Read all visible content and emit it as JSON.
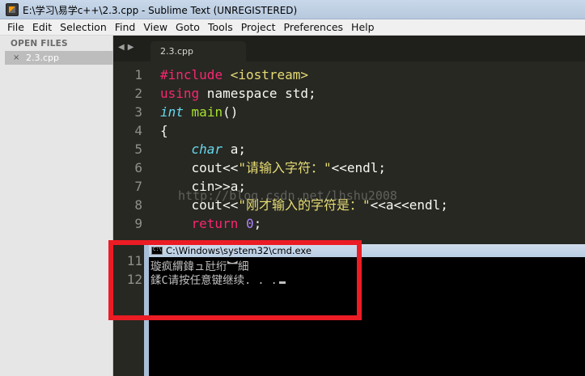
{
  "window": {
    "title": "E:\\学习\\易学c++\\2.3.cpp - Sublime Text (UNREGISTERED)"
  },
  "menu": [
    "File",
    "Edit",
    "Selection",
    "Find",
    "View",
    "Goto",
    "Tools",
    "Project",
    "Preferences",
    "Help"
  ],
  "sidebar": {
    "header": "OPEN FILES",
    "close_glyph": "×",
    "files": [
      "2.3.cpp"
    ]
  },
  "tabs": {
    "nav": "◀▶",
    "active": "2.3.cpp"
  },
  "editor": {
    "line_numbers": [
      "1",
      "2",
      "3",
      "4",
      "5",
      "6",
      "7",
      "8",
      "9",
      "11",
      "12"
    ],
    "watermark": "http://blog.csdn.net/lhshu2008",
    "code": {
      "l1": {
        "hash": "#",
        "kw": "include",
        "sp": " ",
        "hdr": "<iostream>"
      },
      "l2": {
        "kw": "using",
        "rest": " namespace std;"
      },
      "l3": {
        "type": "int",
        "sp": " ",
        "fn": "main",
        "rest": "()"
      },
      "l4": {
        "text": "{"
      },
      "l5": {
        "indent": "    ",
        "type": "char",
        "rest": " a;"
      },
      "l6": {
        "indent": "    ",
        "pre": "cout<<",
        "str": "\"请输入字符：\"",
        "post": "<<endl;"
      },
      "l7": {
        "indent": "    ",
        "text": "cin>>a;"
      },
      "l8": {
        "indent": "    ",
        "pre": "cout<<",
        "str": "\"刚才输入的字符是：\"",
        "post": "<<a<<endl;"
      },
      "l9": {
        "indent": "    ",
        "kw": "return",
        "sp": " ",
        "num": "0",
        "post": ";"
      }
    }
  },
  "cmd": {
    "title": "C:\\Windows\\system32\\cmd.exe",
    "lines": [
      "璇疯緭鍏ュ瓧绗︼細",
      "鍒C请按任意键继续. . ."
    ]
  }
}
